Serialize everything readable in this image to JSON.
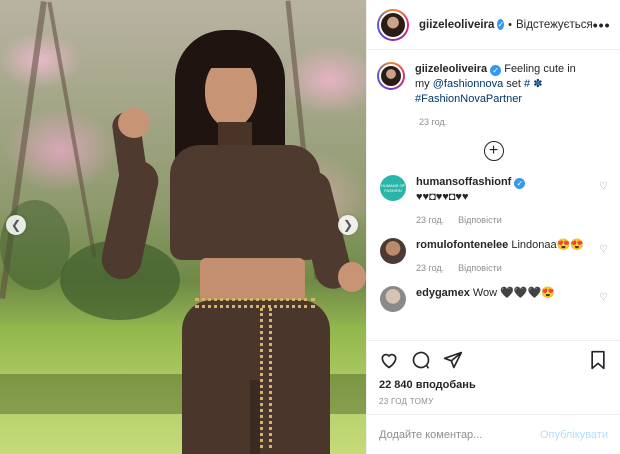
{
  "post": {
    "username": "giizeleoliveira",
    "follow_status": "Відстежується",
    "more": "•••",
    "caption_user": "giizeleoliveira",
    "caption_text": "Feeling cute in my",
    "caption_mention": "@fashionnova",
    "caption_set": "set",
    "caption_hash1": "#",
    "caption_emoji": "✽",
    "caption_hashtag": "#FashionNovaPartner",
    "caption_time": "23 год.",
    "likes": "22 840 вподобань",
    "posted_ago": "23 ГОД ТОМУ",
    "comment_placeholder": "Додайте коментар...",
    "publish_label": "Опублікувати"
  },
  "comments": [
    {
      "user": "humansoffashionf",
      "verified": true,
      "text": "♥♥◘♥♥◘♥♥",
      "time": "23 год.",
      "reply": "Відповісти",
      "avatar_text": "HUMANS OF FASHION"
    },
    {
      "user": "romulofontenelee",
      "verified": false,
      "text": "Lindonaa😍😍",
      "time": "23 год.",
      "reply": "Відповісти"
    },
    {
      "user": "edygamex",
      "verified": false,
      "text": "Wow 🖤🖤🖤😍",
      "time": "",
      "reply": ""
    }
  ],
  "icons": {
    "verified": "verified-badge-icon",
    "arrow_left": "chevron-left-icon",
    "arrow_right": "chevron-right-icon",
    "load_more": "plus-circle-icon",
    "heart": "heart-icon",
    "comment": "comment-icon",
    "share": "share-icon",
    "save": "bookmark-icon"
  },
  "colors": {
    "link": "#00376b",
    "verified": "#3897f0",
    "publish": "#b2dffc",
    "muted": "#8e8e8e"
  }
}
